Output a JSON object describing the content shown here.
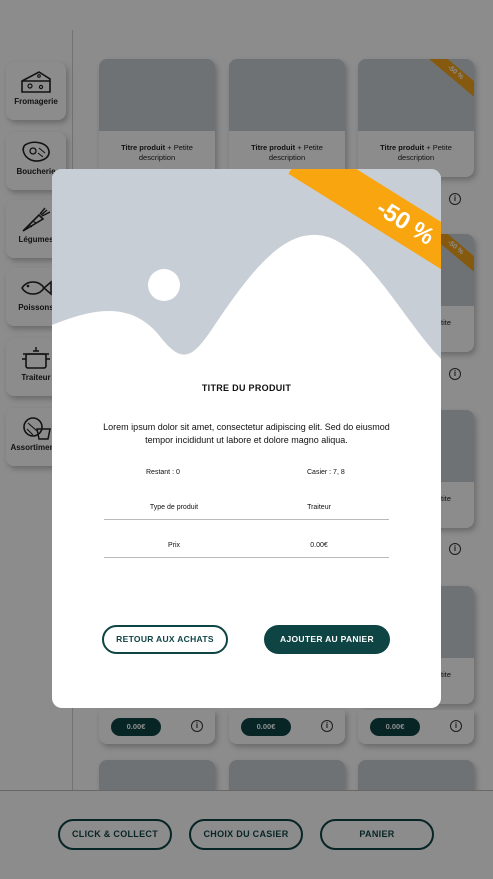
{
  "sidebar": {
    "categories": [
      {
        "label": "Fromagerie",
        "icon": "cheese-icon"
      },
      {
        "label": "Boucherie",
        "icon": "steak-icon"
      },
      {
        "label": "Légumes",
        "icon": "carrot-icon"
      },
      {
        "label": "Poissons",
        "icon": "fish-icon"
      },
      {
        "label": "Traiteur",
        "icon": "pot-icon"
      },
      {
        "label": "Assortiments",
        "icon": "basket-icon"
      }
    ]
  },
  "grid": {
    "card_title_bold": "Titre produit",
    "card_title_rest": " + Petite description",
    "discount_label": "-50 %",
    "price": "0.00€",
    "info_glyph": "i",
    "title_snippet": "tite"
  },
  "footer": {
    "click_collect": "CLICK & COLLECT",
    "locker_choice": "CHOIX DU CASIER",
    "cart": "PANIER"
  },
  "modal": {
    "discount": "-50 %",
    "title": "TITRE DU PRODUIT",
    "description": "Lorem ipsum dolor sit amet, consectetur adipiscing elit. Sed do eiusmod tempor incididunt ut labore et dolore magno aliqua.",
    "remaining": "Restant : 0",
    "locker": "Casier : 7, 8",
    "type_label": "Type de produit",
    "type_value": "Traiteur",
    "price_label": "Prix",
    "price_value": "0.00€",
    "back_button": "RETOUR AUX ACHATS",
    "add_button": "AJOUTER AU PANIER"
  },
  "colors": {
    "brand_dark": "#0f4445",
    "discount_orange": "#f9a50f",
    "placeholder_grey": "#c8ced6"
  }
}
